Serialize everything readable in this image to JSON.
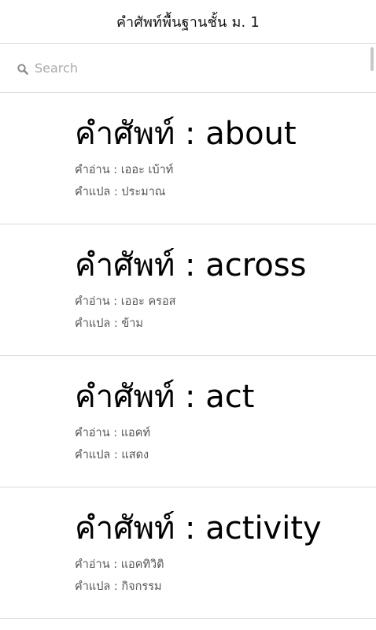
{
  "header": {
    "title": "คำศัพท์พื้นฐานชั้น ม. 1"
  },
  "search": {
    "placeholder": "Search",
    "value": "",
    "icon": "search-icon"
  },
  "words": [
    {
      "heading": "คำศัพท์ : about",
      "reading": "คำอ่าน : เออะ เบ้าท์",
      "meaning": "คำแปล : ประมาณ"
    },
    {
      "heading": "คำศัพท์ : across",
      "reading": "คำอ่าน : เออะ ครอส",
      "meaning": "คำแปล : ข้าม"
    },
    {
      "heading": "คำศัพท์ : act",
      "reading": "คำอ่าน : แอคท์",
      "meaning": "คำแปล : แสดง"
    },
    {
      "heading": "คำศัพท์ : activity",
      "reading": "คำอ่าน : แอคทิวิติ",
      "meaning": "คำแปล : กิจกรรม"
    }
  ],
  "colors": {
    "background": "#ffffff",
    "divider": "#dcdcdc",
    "placeholder": "#a9a9a9",
    "detail_text": "#555555"
  }
}
